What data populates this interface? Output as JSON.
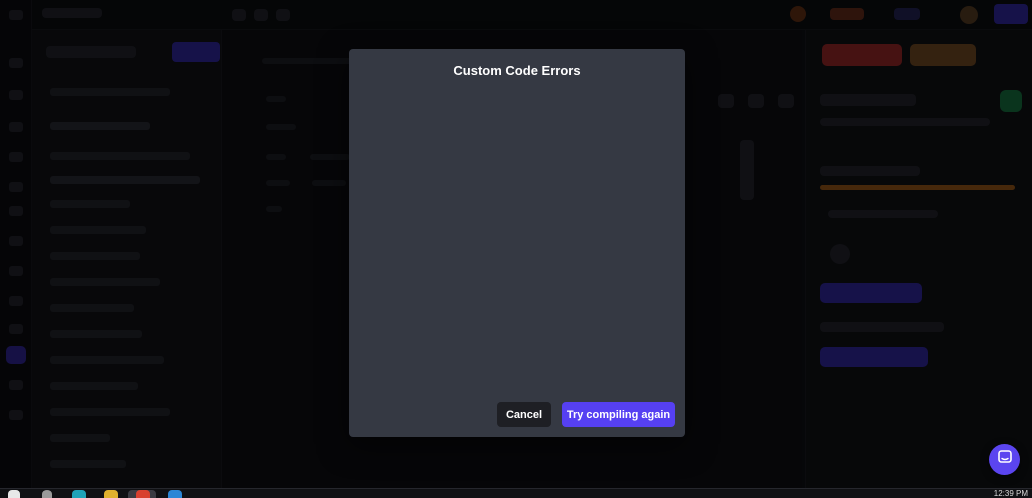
{
  "modal": {
    "title": "Custom Code Errors",
    "cancel_label": "Cancel",
    "retry_label": "Try compiling again"
  },
  "chat": {
    "icon": "chat-bubble-icon"
  },
  "taskbar": {
    "time": "12:39 PM",
    "icons": [
      "windows-start-icon",
      "search-icon",
      "edge-browser-icon",
      "file-explorer-icon",
      "chrome-icon",
      "vscode-icon"
    ]
  },
  "colors": {
    "modal_bg": "#353943",
    "primary_button": "#5640f2",
    "cancel_button": "#1e1f24",
    "overlay": "rgba(0,0,0,0.62)"
  }
}
